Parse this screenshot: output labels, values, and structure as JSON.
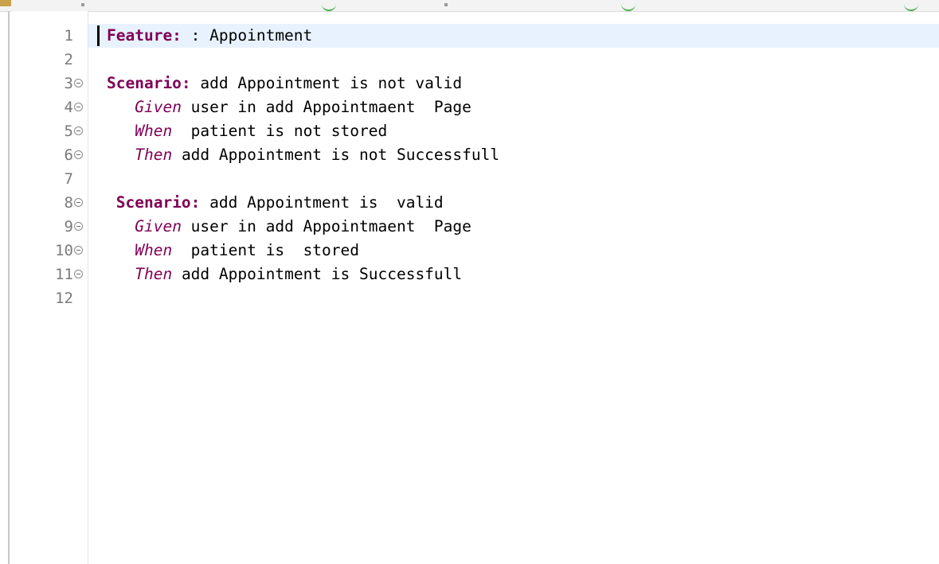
{
  "editor": {
    "lines": [
      {
        "number": "1",
        "keyword": "Feature:",
        "text": " : Appointment",
        "indent": "",
        "kind": "feature",
        "fold": false
      },
      {
        "number": "2",
        "keyword": "",
        "text": "",
        "indent": "",
        "kind": "blank",
        "fold": false
      },
      {
        "number": "3",
        "keyword": "Scenario:",
        "text": " add Appointment is not valid",
        "indent": "",
        "kind": "scenario",
        "fold": true
      },
      {
        "number": "4",
        "keyword": "Given",
        "text": " user in add Appointmaent  Page",
        "indent": "   ",
        "kind": "step",
        "fold": true
      },
      {
        "number": "5",
        "keyword": "When",
        "text": "  patient is not stored",
        "indent": "   ",
        "kind": "step",
        "fold": true
      },
      {
        "number": "6",
        "keyword": "Then",
        "text": " add Appointment is not Successfull",
        "indent": "   ",
        "kind": "step",
        "fold": true
      },
      {
        "number": "7",
        "keyword": "",
        "text": "",
        "indent": "",
        "kind": "blank",
        "fold": false
      },
      {
        "number": "8",
        "keyword": "Scenario:",
        "text": " add Appointment is  valid",
        "indent": " ",
        "kind": "scenario",
        "fold": true
      },
      {
        "number": "9",
        "keyword": "Given",
        "text": " user in add Appointmaent  Page",
        "indent": "   ",
        "kind": "step",
        "fold": true
      },
      {
        "number": "10",
        "keyword": "When",
        "text": "  patient is  stored",
        "indent": "   ",
        "kind": "step",
        "fold": true
      },
      {
        "number": "11",
        "keyword": "Then",
        "text": " add Appointment is Successfull",
        "indent": "   ",
        "kind": "step",
        "fold": true
      },
      {
        "number": "12",
        "keyword": "",
        "text": "",
        "indent": "",
        "kind": "blank",
        "fold": false
      }
    ],
    "current_line": 1,
    "colors": {
      "keyword": "#7f0055",
      "line_number": "#7a7a7a",
      "current_line_highlight": "#e8f2fe"
    },
    "icons": {
      "fold": "collapse-fold-icon"
    }
  }
}
